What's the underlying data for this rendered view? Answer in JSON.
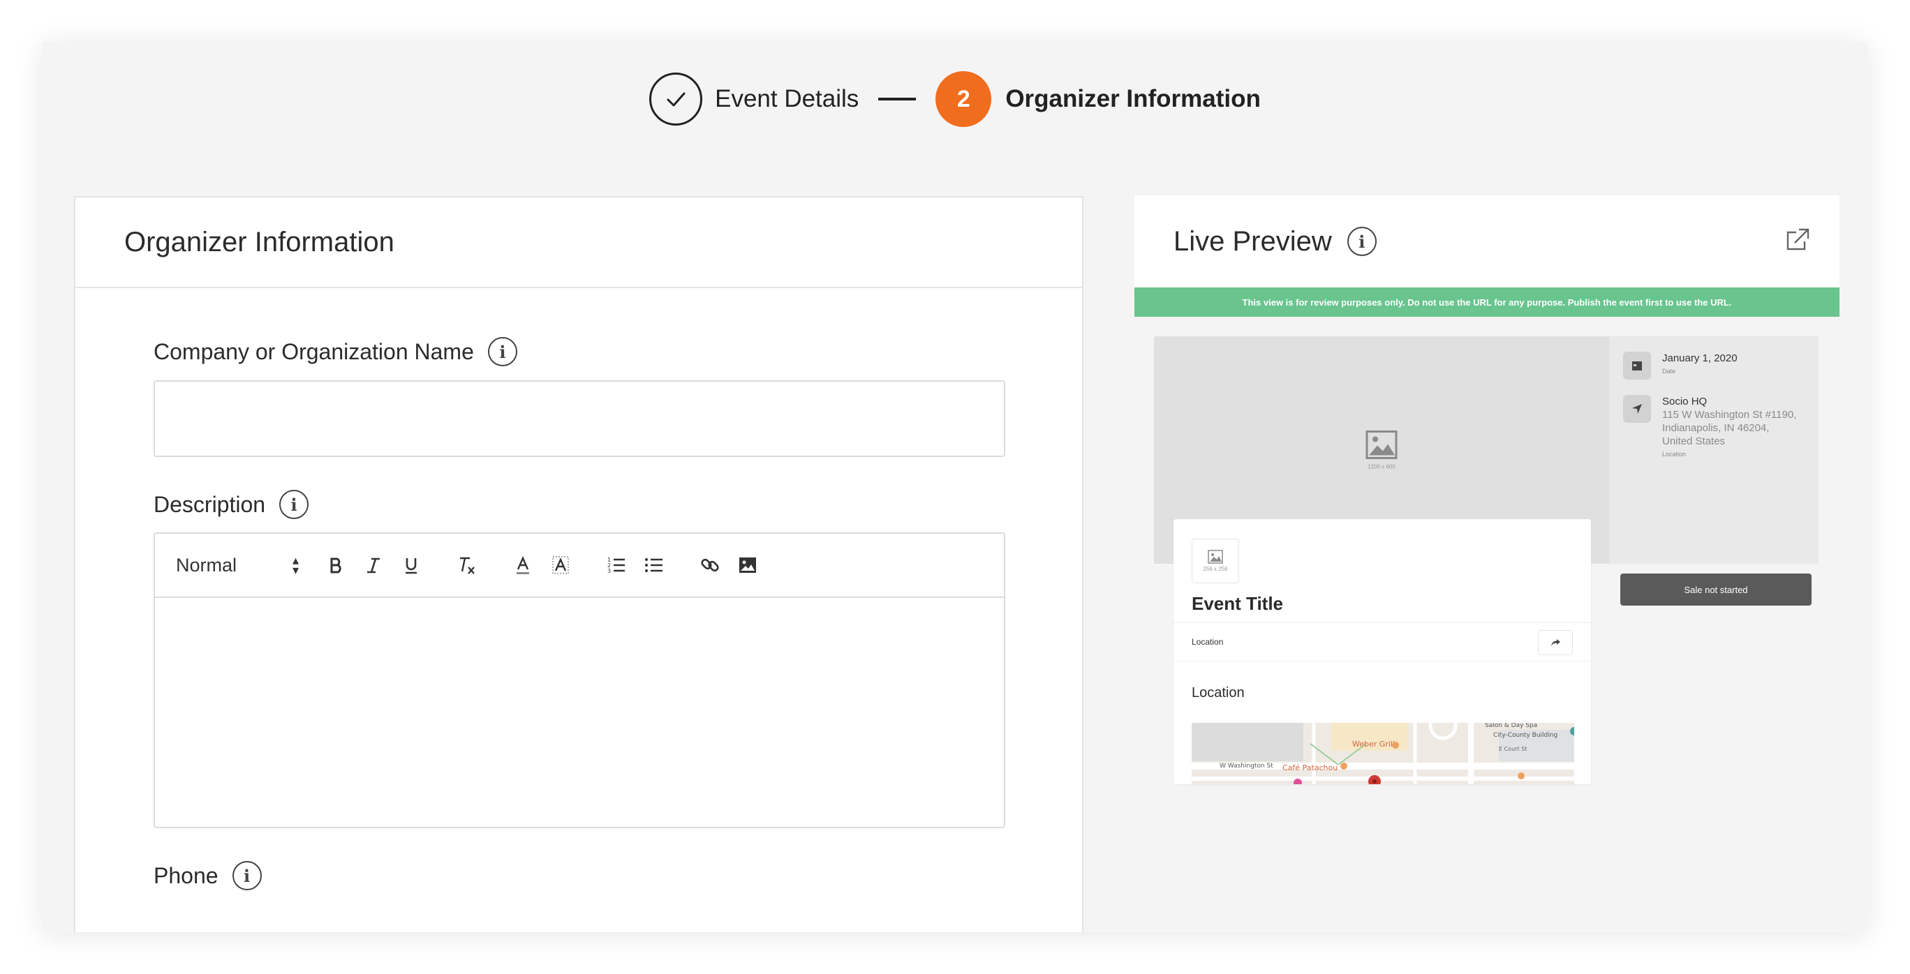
{
  "stepper": {
    "step1_label": "Event Details",
    "step2_number": "2",
    "step2_label": "Organizer Information",
    "accent_color": "#f06d1e"
  },
  "form": {
    "title": "Organizer Information",
    "company_label": "Company or Organization Name",
    "company_value": "",
    "description_label": "Description",
    "format_select": "Normal",
    "phone_label": "Phone",
    "phone_value": ""
  },
  "preview": {
    "title": "Live Preview",
    "banner": "This view is for review purposes only. Do not use the URL for any purpose. Publish the event first to use the URL.",
    "banner_color": "#69c48e",
    "hero_placeholder": "1200 x 600",
    "date": "January 1, 2020",
    "date_caption": "Date",
    "venue_name": "Socio HQ",
    "venue_addr1": "115 W Washington St #1190,",
    "venue_addr2": "Indianapolis, IN 46204,",
    "venue_addr3": "United States",
    "location_caption": "Location",
    "sale_button": "Sale not started",
    "thumb_placeholder": "256 x 256",
    "event_title": "Event Title",
    "location_row": "Location",
    "location_heading": "Location",
    "map_labels": [
      "Weber Grill",
      "W Washington St",
      "Café Patachou",
      "City-County Building",
      "Salon & Day Spa",
      "E Court St"
    ]
  }
}
